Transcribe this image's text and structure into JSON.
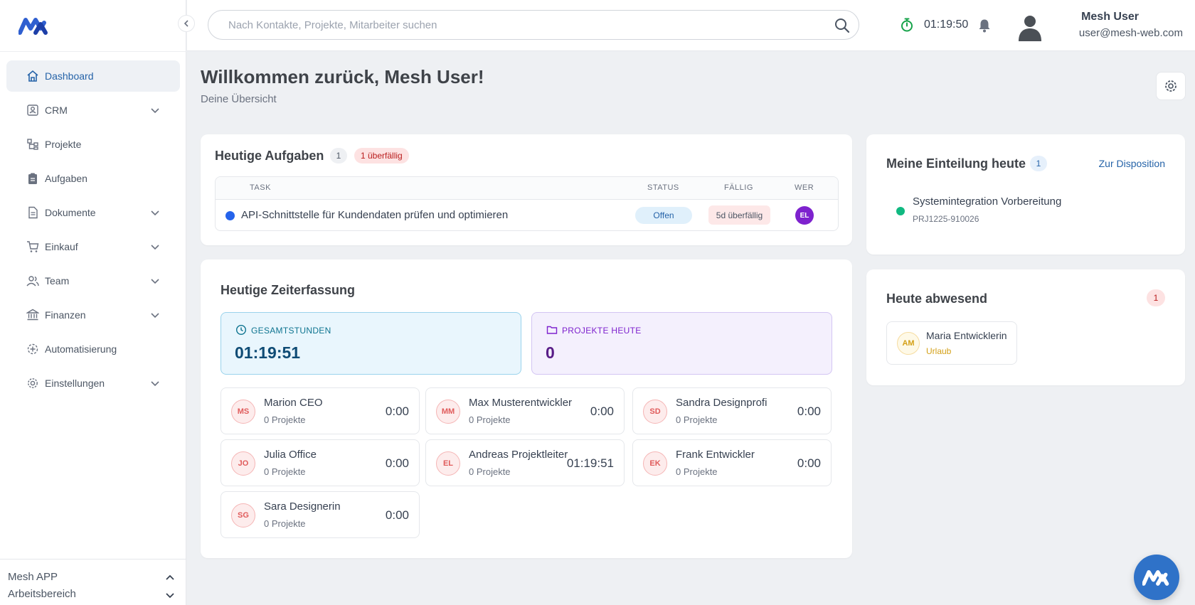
{
  "colors": {
    "accent": "#2563a8",
    "brand_blue": "#2f72c8",
    "danger": "#b91c1c",
    "success": "#10b981",
    "purple": "#7e22ce"
  },
  "sidebar": {
    "items": [
      {
        "label": "Dashboard",
        "icon": "home-icon",
        "active": true,
        "expandable": false
      },
      {
        "label": "CRM",
        "icon": "contacts-icon",
        "expandable": true
      },
      {
        "label": "Projekte",
        "icon": "project-icon",
        "expandable": false
      },
      {
        "label": "Aufgaben",
        "icon": "clipboard-icon",
        "expandable": false
      },
      {
        "label": "Dokumente",
        "icon": "document-icon",
        "expandable": true
      },
      {
        "label": "Einkauf",
        "icon": "cart-icon",
        "expandable": true
      },
      {
        "label": "Team",
        "icon": "users-icon",
        "expandable": true
      },
      {
        "label": "Finanzen",
        "icon": "bank-icon",
        "expandable": true
      },
      {
        "label": "Automatisierung",
        "icon": "automation-icon",
        "expandable": false
      },
      {
        "label": "Einstellungen",
        "icon": "gear-icon",
        "expandable": true
      }
    ],
    "footer": {
      "app": "Mesh APP",
      "workspace": "Arbeitsbereich"
    }
  },
  "topbar": {
    "search_placeholder": "Nach Kontakte, Projekte, Mitarbeiter suchen",
    "timer": "01:19:50",
    "user_name": "Mesh User",
    "user_email": "user@mesh-web.com"
  },
  "page": {
    "title": "Willkommen zurück, Mesh User!",
    "subtitle": "Deine Übersicht"
  },
  "tasks": {
    "title": "Heutige Aufgaben",
    "count": "1",
    "overdue": "1 überfällig",
    "columns": [
      "TASK",
      "STATUS",
      "FÄLLIG",
      "WER"
    ],
    "rows": [
      {
        "task": "API-Schnittstelle für Kundendaten prüfen und optimieren",
        "status": "Offen",
        "due": "5d überfällig",
        "who": "EL"
      }
    ]
  },
  "time": {
    "title": "Heutige Zeiterfassung",
    "total_label": "GESAMTSTUNDEN",
    "total_value": "01:19:51",
    "projects_label": "PROJEKTE HEUTE",
    "projects_value": "0",
    "employees": [
      {
        "initials": "MS",
        "name": "Marion CEO",
        "projects": "0 Projekte",
        "time": "0:00"
      },
      {
        "initials": "MM",
        "name": "Max Musterentwickler",
        "projects": "0 Projekte",
        "time": "0:00"
      },
      {
        "initials": "SD",
        "name": "Sandra Designprofi",
        "projects": "0 Projekte",
        "time": "0:00"
      },
      {
        "initials": "JO",
        "name": "Julia Office",
        "projects": "0 Projekte",
        "time": "0:00"
      },
      {
        "initials": "EL",
        "name": "Andreas Projektleiter",
        "projects": "0 Projekte",
        "time": "01:19:51"
      },
      {
        "initials": "EK",
        "name": "Frank Entwickler",
        "projects": "0 Projekte",
        "time": "0:00"
      },
      {
        "initials": "SG",
        "name": "Sara Designerin",
        "projects": "0 Projekte",
        "time": "0:00"
      }
    ]
  },
  "assignment": {
    "title": "Meine Einteilung heute",
    "count": "1",
    "link": "Zur Disposition",
    "item_title": "Systemintegration Vorbereitung",
    "item_code": "PRJ1225-910026"
  },
  "absent": {
    "title": "Heute abwesend",
    "count": "1",
    "person": {
      "initials": "AM",
      "name": "Maria Entwicklerin",
      "reason": "Urlaub"
    }
  }
}
